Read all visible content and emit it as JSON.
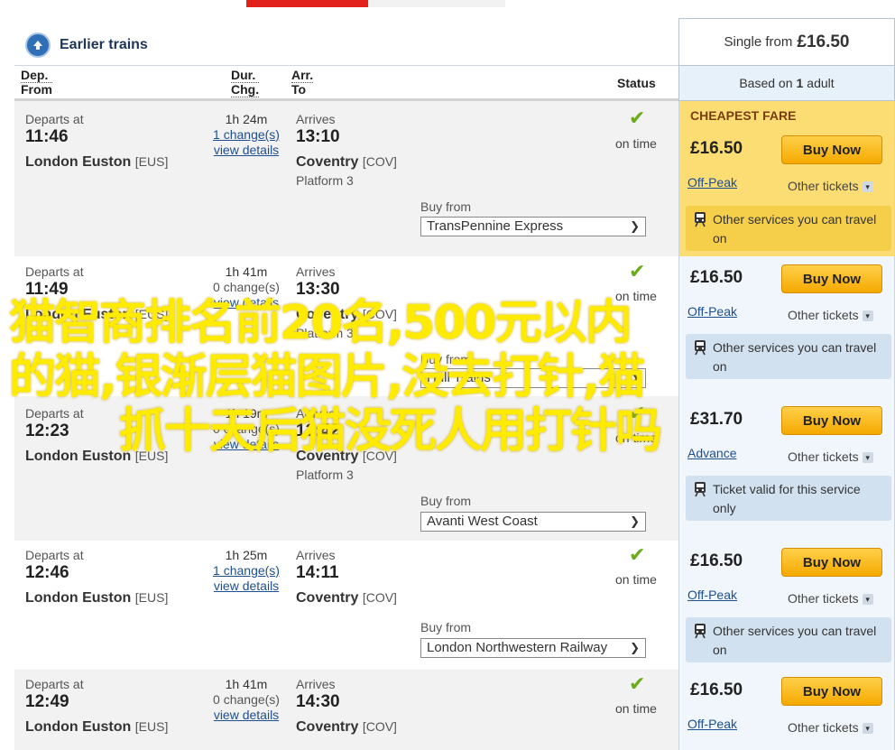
{
  "earlier": {
    "label": "Earlier trains"
  },
  "header": {
    "dep_line1": "Dep.",
    "dep_line2": "From",
    "dur_line1": "Dur.",
    "dur_line2": "Chg.",
    "arr_line1": "Arr.",
    "arr_line2": "To",
    "status": "Status"
  },
  "price_header": {
    "single_from": "Single from",
    "single_price": "£16.50",
    "based_on": "Based on",
    "adults": "1",
    "adult_word": "adult",
    "cheapest_label": "CHEAPEST FARE"
  },
  "journeys": [
    {
      "departs_label": "Departs at",
      "depart_time": "11:46",
      "from_station": "London Euston",
      "from_code": "[EUS]",
      "duration": "1h 24m",
      "changes": "1 change(s)",
      "details": "view details",
      "arrives_label": "Arrives",
      "arrive_time": "13:10",
      "to_station": "Coventry",
      "to_code": "[COV]",
      "platform": "Platform 3",
      "status": "on time",
      "buy_from_label": "Buy from",
      "operator": "TransPennine Express",
      "price": "£16.50",
      "buy_label": "Buy Now",
      "fare_type": "Off-Peak",
      "other_tickets": "Other tickets",
      "note": "Other services you can travel on"
    },
    {
      "departs_label": "Departs at",
      "depart_time": "11:49",
      "from_station": "London Euston",
      "from_code": "[EUS]",
      "duration": "1h 41m",
      "changes": "0 change(s)",
      "details": "view details",
      "arrives_label": "Arrives",
      "arrive_time": "13:30",
      "to_station": "Coventry",
      "to_code": "[COV]",
      "platform": "Platform 3",
      "status": "on time",
      "buy_from_label": "Buy from",
      "operator": "Hull Trains",
      "price": "£16.50",
      "buy_label": "Buy Now",
      "fare_type": "Off-Peak",
      "other_tickets": "Other tickets",
      "note": "Other services you can travel on"
    },
    {
      "departs_label": "Departs at",
      "depart_time": "12:23",
      "from_station": "London Euston",
      "from_code": "[EUS]",
      "duration": "1h 19m",
      "changes": "0 change(s)",
      "details": "view details",
      "arrives_label": "Arrives",
      "arrive_time": "13:42",
      "to_station": "Coventry",
      "to_code": "[COV]",
      "platform": "Platform 3",
      "status": "on time",
      "buy_from_label": "Buy from",
      "operator": "Avanti West Coast",
      "price": "£31.70",
      "buy_label": "Buy Now",
      "fare_type": "Advance",
      "other_tickets": "Other tickets",
      "note": "Ticket valid for this service only"
    },
    {
      "departs_label": "Departs at",
      "depart_time": "12:46",
      "from_station": "London Euston",
      "from_code": "[EUS]",
      "duration": "1h 25m",
      "changes": "1 change(s)",
      "details": "view details",
      "arrives_label": "Arrives",
      "arrive_time": "14:11",
      "to_station": "Coventry",
      "to_code": "[COV]",
      "platform": "",
      "status": "on time",
      "buy_from_label": "Buy from",
      "operator": "London Northwestern Railway",
      "price": "£16.50",
      "buy_label": "Buy Now",
      "fare_type": "Off-Peak",
      "other_tickets": "Other tickets",
      "note": "Other services you can travel on"
    },
    {
      "departs_label": "Departs at",
      "depart_time": "12:49",
      "from_station": "London Euston",
      "from_code": "[EUS]",
      "duration": "1h 41m",
      "changes": "0 change(s)",
      "details": "view details",
      "arrives_label": "Arrives",
      "arrive_time": "14:30",
      "to_station": "Coventry",
      "to_code": "[COV]",
      "platform": "",
      "status": "on time",
      "buy_from_label": "",
      "operator": "",
      "price": "£16.50",
      "buy_label": "Buy Now",
      "fare_type": "Off-Peak",
      "other_tickets": "Other tickets",
      "note": ""
    }
  ],
  "overlay": {
    "line1": "猫智商排名前20名,500元以内",
    "line2": "的猫,银渐层猫图片,没去打针,猫",
    "line3": "抓十天后猫没死人用打针吗"
  },
  "colors": {
    "accent_red": "#e2211c",
    "cheapest_bg": "#fbdd74",
    "buy_button": "#f5a900",
    "link_blue": "#1e4f91",
    "on_time_tick": "#6aab1e",
    "overlay_text": "#ffeb00"
  }
}
